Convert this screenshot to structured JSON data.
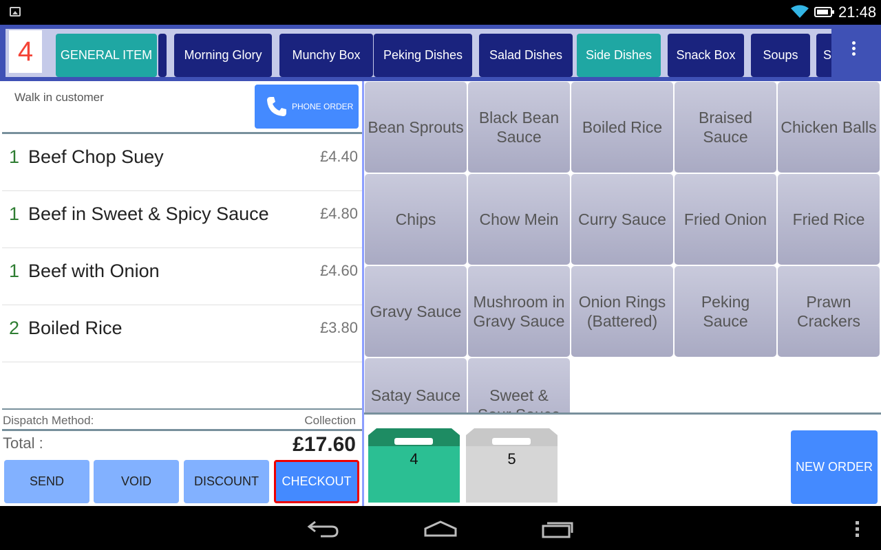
{
  "status_bar": {
    "time": "21:48"
  },
  "order_number": "4",
  "categories": [
    {
      "label": "GENERAL ITEM",
      "active": true
    },
    {
      "label": "Morning Glory",
      "active": false
    },
    {
      "label": "Munchy Box",
      "active": false
    },
    {
      "label": "Peking Dishes",
      "active": false
    },
    {
      "label": "Salad Dishes",
      "active": false
    },
    {
      "label": "Side Dishes",
      "active": true
    },
    {
      "label": "Snack Box",
      "active": false
    },
    {
      "label": "Soups",
      "active": false
    },
    {
      "label": "S",
      "active": false
    }
  ],
  "order": {
    "customer": "Walk in customer",
    "phone_order_label": "PHONE ORDER",
    "lines": [
      {
        "qty": "1",
        "name": "Beef Chop Suey",
        "price": "£4.40"
      },
      {
        "qty": "1",
        "name": "Beef in Sweet & Spicy Sauce",
        "price": "£4.80"
      },
      {
        "qty": "1",
        "name": "Beef with Onion",
        "price": "£4.60"
      },
      {
        "qty": "2",
        "name": "Boiled Rice",
        "price": "£3.80"
      }
    ],
    "dispatch_label": "Dispatch Method:",
    "dispatch_value": "Collection",
    "total_label": "Total :",
    "total_value": "£17.60"
  },
  "actions": {
    "send": "SEND",
    "void": "VOID",
    "discount": "DISCOUNT",
    "checkout": "CHECKOUT"
  },
  "items": [
    "Bean Sprouts",
    "Black Bean Sauce",
    "Boiled Rice",
    "Braised Sauce",
    "Chicken Balls",
    "Chips",
    "Chow Mein",
    "Curry Sauce",
    "Fried Onion",
    "Fried Rice",
    "Gravy Sauce",
    "Mushroom in Gravy Sauce",
    "Onion Rings (Battered)",
    "Peking Sauce",
    "Prawn Crackers",
    "Satay Sauce",
    "Sweet & Sour Sauce"
  ],
  "bags": [
    {
      "number": "4",
      "color": "#2bbf93",
      "top_color": "#1e8c63"
    },
    {
      "number": "5",
      "color": "#d6d6d6",
      "top_color": "#c8c8c8"
    }
  ],
  "new_order_label": "NEW ORDER",
  "colors": {
    "accent_blue": "#448aff",
    "category_bar": "#3f51b5",
    "category_button": "#1a237e",
    "category_active": "#1fa7a3",
    "quantity_green": "#2e7d32",
    "order_number_red": "#f44336"
  }
}
